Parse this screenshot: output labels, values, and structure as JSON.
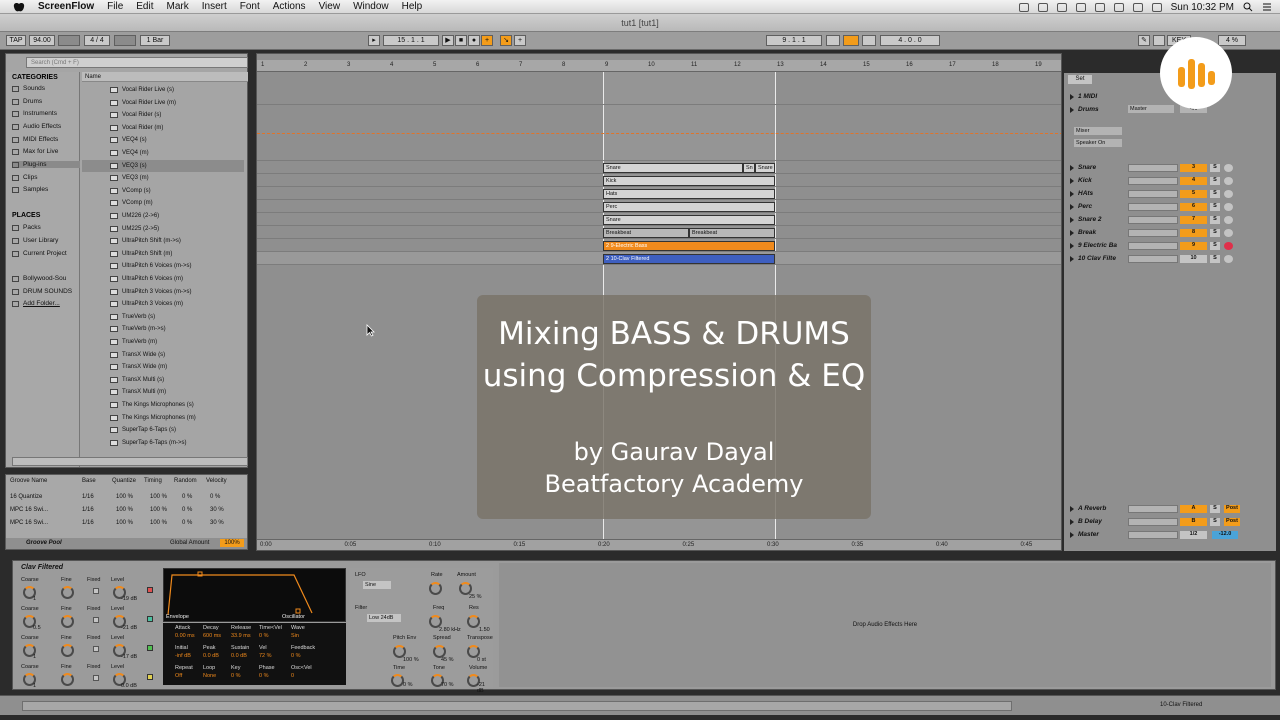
{
  "menubar": {
    "app": "ScreenFlow",
    "items": [
      "File",
      "Edit",
      "Mark",
      "Insert",
      "Font",
      "Actions",
      "View",
      "Window",
      "Help"
    ],
    "clock": "Sun 10:32 PM"
  },
  "window_title": "tut1  [tut1]",
  "control": {
    "tap": "TAP",
    "tempo": "94.00",
    "sig": "4 / 4",
    "quant": "1 Bar",
    "pos": "15 . 1 . 1",
    "loop_start": "9 . 1 . 1",
    "loop_len": "4 . 0 . 0",
    "key": "KEY",
    "cpu": "4 %"
  },
  "browser": {
    "search_placeholder": "Search (Cmd + F)",
    "categories_title": "CATEGORIES",
    "categories": [
      "Sounds",
      "Drums",
      "Instruments",
      "Audio Effects",
      "MIDI Effects",
      "Max for Live",
      "Plug-ins",
      "Clips",
      "Samples"
    ],
    "places_title": "PLACES",
    "places": [
      "Packs",
      "User Library",
      "Current Project",
      "Bollywood-Sou",
      "DRUM SOUNDS",
      "Add Folder..."
    ],
    "name_header": "Name",
    "files": [
      "Vocal Rider Live (s)",
      "Vocal Rider Live (m)",
      "Vocal Rider (s)",
      "Vocal Rider (m)",
      "VEQ4 (s)",
      "VEQ4 (m)",
      "VEQ3 (s)",
      "VEQ3 (m)",
      "VComp (s)",
      "VComp (m)",
      "UM226 (2->6)",
      "UM225 (2->5)",
      "UltraPitch Shift (m->s)",
      "UltraPitch Shift (m)",
      "UltraPitch 6 Voices (m->s)",
      "UltraPitch 6 Voices (m)",
      "UltraPitch 3 Voices (m->s)",
      "UltraPitch 3 Voices (m)",
      "TrueVerb (s)",
      "TrueVerb (m->s)",
      "TrueVerb (m)",
      "TransX Wide (s)",
      "TransX Wide (m)",
      "TransX Multi (s)",
      "TransX Multi (m)",
      "The Kings Microphones (s)",
      "The Kings Microphones (m)",
      "SuperTap 6-Taps (s)",
      "SuperTap 6-Taps (m->s)"
    ]
  },
  "groove": {
    "headers": [
      "Groove Name",
      "Base",
      "Quantize",
      "Timing",
      "Random",
      "Velocity"
    ],
    "rows": [
      [
        "16 Quantize",
        "1/16",
        "100 %",
        "100 %",
        "0 %",
        "0 %"
      ],
      [
        "MPC 16 Swi...",
        "1/16",
        "100 %",
        "100 %",
        "0 %",
        "30 %"
      ],
      [
        "MPC 16 Swi...",
        "1/16",
        "100 %",
        "100 %",
        "0 %",
        "30 %"
      ]
    ],
    "footer": "Groove Pool",
    "global": "Global Amount",
    "global_val": "100%"
  },
  "ruler": [
    "1",
    "2",
    "3",
    "4",
    "5",
    "6",
    "7",
    "8",
    "9",
    "10",
    "11",
    "12",
    "13",
    "14",
    "15",
    "16",
    "17",
    "18",
    "19"
  ],
  "timeline": [
    "0:00",
    "0:05",
    "0:10",
    "0:15",
    "0:20",
    "0:25",
    "0:30",
    "0:35",
    "0:40",
    "0:45"
  ],
  "clips": {
    "snare": "Snare",
    "kick": "Kick",
    "hats": "Hats",
    "perc": "Perc",
    "snare2": "Snare",
    "break_a": "Breakbeat",
    "break_b": "Breakbeat",
    "bass": "2 9-Electric Bass",
    "clav": "2 10-Clav Filtered"
  },
  "card": {
    "line1": "Mixing BASS & DRUMS",
    "line2": "using Compression & EQ",
    "line3": "by Gaurav Dayal",
    "line4": "Beatfactory Academy"
  },
  "mixer": {
    "set": "Set",
    "tracks": [
      {
        "name": "1 MIDI",
        "num": ""
      },
      {
        "name": "Drums",
        "num": ""
      },
      {
        "name": "Snare",
        "num": "3"
      },
      {
        "name": "Kick",
        "num": "4"
      },
      {
        "name": "HAts",
        "num": "5"
      },
      {
        "name": "Perc",
        "num": "6"
      },
      {
        "name": "Snare 2",
        "num": "7"
      },
      {
        "name": "Break",
        "num": "8"
      },
      {
        "name": "9 Electric Ba",
        "num": "9"
      },
      {
        "name": "10 Clav Filte",
        "num": "10"
      }
    ],
    "returns": [
      {
        "name": "A Reverb",
        "num": "A"
      },
      {
        "name": "B Delay",
        "num": "B"
      },
      {
        "name": "Master",
        "num": "1/2"
      }
    ],
    "master_route": "Master",
    "mixer_label": "Mixer",
    "speaker": "Speaker On",
    "inf": "-inf",
    "post": "Post",
    "master_vol": "-12.0"
  },
  "device": {
    "title": "Clav Filtered",
    "op_labels": [
      "Coarse",
      "Fine",
      "Fixed",
      "Level"
    ],
    "levels": [
      "-19 dB",
      "-21 dB",
      "-17 dB",
      "0.0 dB"
    ],
    "coarse": [
      "1",
      "0.5",
      "1",
      "1"
    ],
    "env_tab": "Envelope",
    "osc_tab": "Oscillator",
    "env_labels": [
      "Attack",
      "Decay",
      "Release",
      "Time<Vel",
      "Wave",
      "Initial",
      "Peak",
      "Sustain",
      "Vel",
      "Feedback",
      "Repeat",
      "Loop",
      "Key",
      "Phase",
      "Osc<Vel"
    ],
    "env_values": [
      "0.00 ms",
      "600 ms",
      "33.9 ms",
      "0 %",
      "Sin",
      "-inf dB",
      "0.0 dB",
      "0.0 dB",
      "72 %",
      "0 %",
      "Off",
      "None",
      "0 %",
      "0 %",
      "0"
    ],
    "lfo": "LFO",
    "lfo_wave": "Sine",
    "rate": "Rate",
    "amount": "Amount",
    "amount_val": "25 %",
    "filter": "Filter",
    "filter_type": "Low 24dB",
    "freq": "Freq",
    "freq_val": "2.80 kHz",
    "res": "Res",
    "res_val": "1.50",
    "pitch_env": "Pitch Env",
    "pitch_env_val": "100 %",
    "spread": "Spread",
    "spread_val": "45 %",
    "transpose": "Transpose",
    "transpose_val": "0 st",
    "time": "Time",
    "time_val": "0 %",
    "tone": "Tone",
    "tone_val": "70 %",
    "volume": "Volume",
    "volume_val": "-21 dB",
    "drop": "Drop Audio Effects Here"
  },
  "status": "10-Clav Filtered"
}
